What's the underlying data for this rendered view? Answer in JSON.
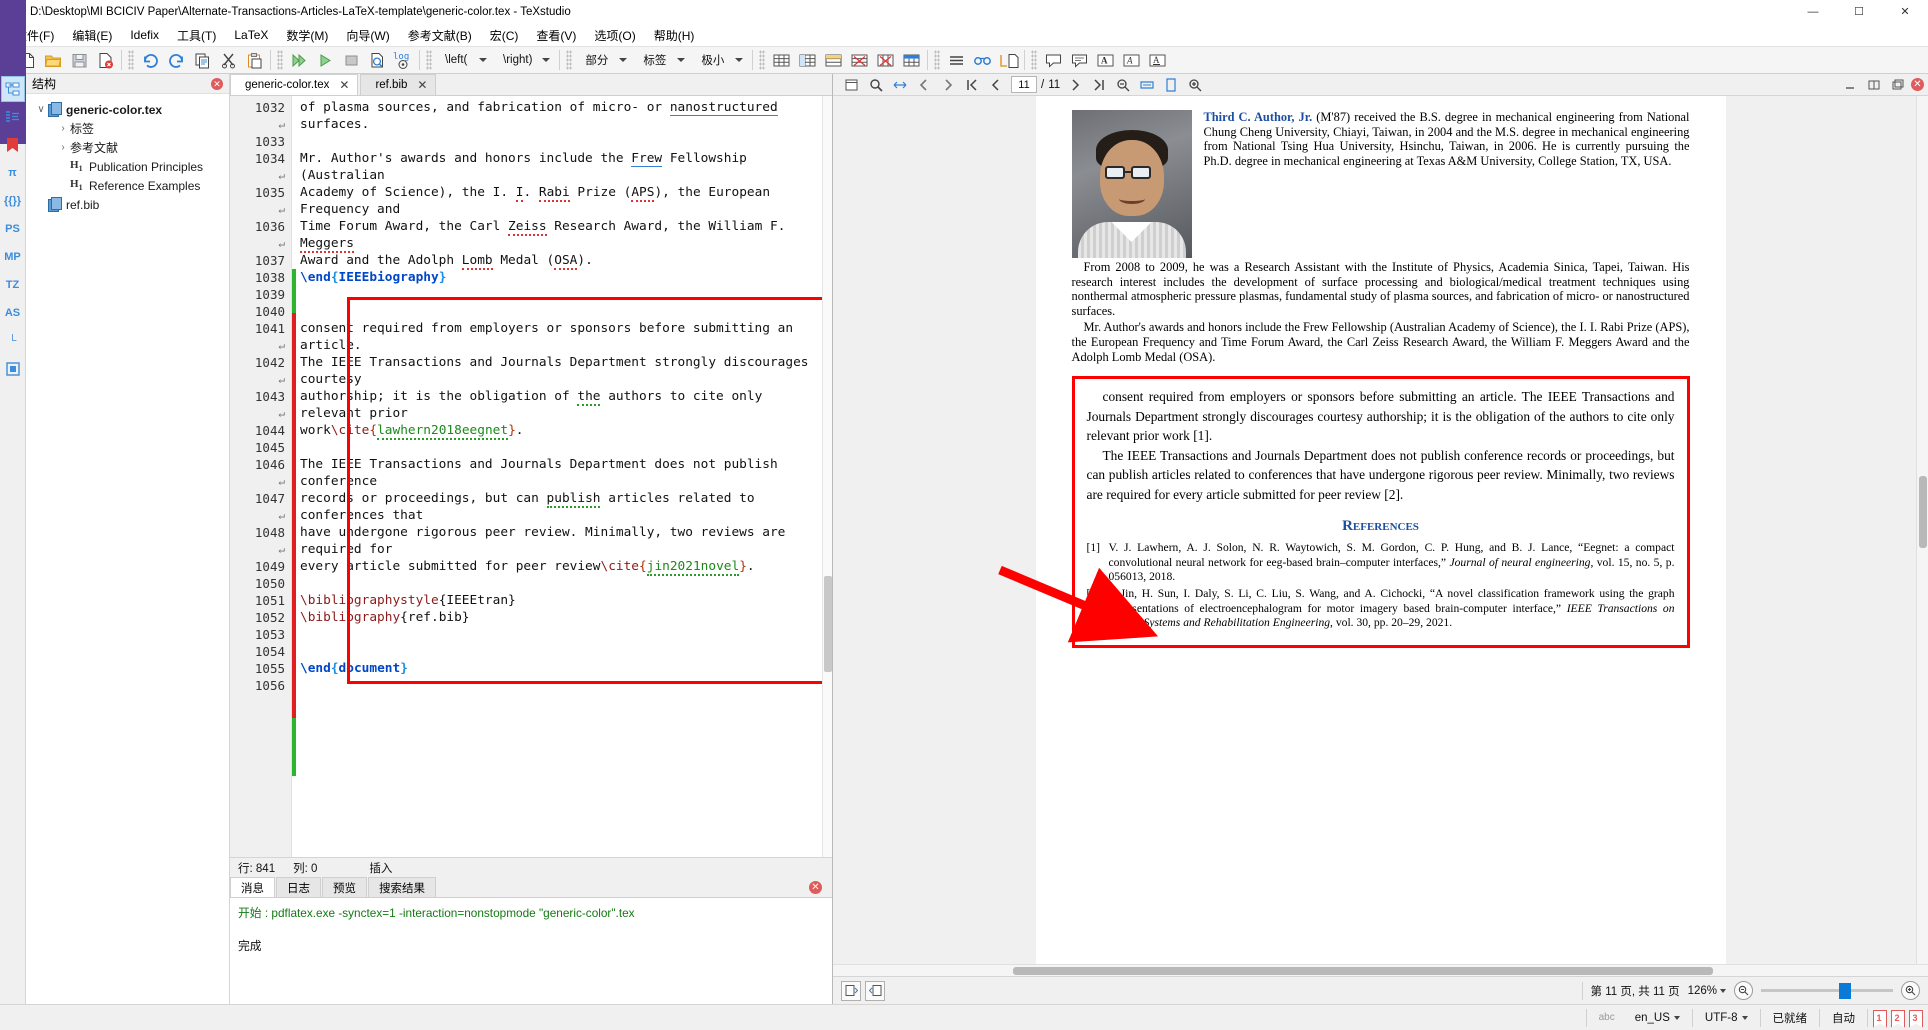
{
  "window": {
    "title": "D:\\Desktop\\MI BCICIV Paper\\Alternate-Transactions-Articles-LaTeX-template\\generic-color.tex - TeXstudio",
    "minimize": "—",
    "maximize": "☐",
    "close": "✕"
  },
  "menubar": [
    {
      "label": "文件(F)"
    },
    {
      "label": "编辑(E)"
    },
    {
      "label": "Idefix"
    },
    {
      "label": "工具(T)"
    },
    {
      "label": "LaTeX"
    },
    {
      "label": "数学(M)"
    },
    {
      "label": "向导(W)"
    },
    {
      "label": "参考文献(B)"
    },
    {
      "label": "宏(C)"
    },
    {
      "label": "查看(V)"
    },
    {
      "label": "选项(O)"
    },
    {
      "label": "帮助(H)"
    }
  ],
  "toolbar": {
    "combos": [
      {
        "name": "left-bracket",
        "label": "\\left("
      },
      {
        "name": "right-bracket",
        "label": "\\right)"
      },
      {
        "name": "section",
        "label": "部分"
      },
      {
        "name": "label",
        "label": "标签"
      },
      {
        "name": "size",
        "label": "极小"
      }
    ],
    "log_label": "log"
  },
  "rail": {
    "items": [
      {
        "name": "structure-view",
        "label": "☰"
      },
      {
        "name": "outline-view",
        "label": "≡"
      },
      {
        "name": "bookmarks",
        "label": "▮"
      },
      {
        "name": "symbols-pi",
        "label": "π"
      },
      {
        "name": "symbols-braces",
        "label": "{{}}"
      },
      {
        "name": "symbols-ps",
        "label": "PS"
      },
      {
        "name": "symbols-mp",
        "label": "MP"
      },
      {
        "name": "symbols-tz",
        "label": "TZ"
      },
      {
        "name": "symbols-as",
        "label": "AS"
      },
      {
        "name": "symbols-l",
        "label": "└"
      },
      {
        "name": "symbols-misc",
        "label": "▣"
      }
    ]
  },
  "structure": {
    "header": "结构",
    "tree": [
      {
        "indent": 0,
        "twisty": "∨",
        "icon": "doc",
        "label": "generic-color.tex",
        "bold": true
      },
      {
        "indent": 1,
        "twisty": "›",
        "icon": "none",
        "label": "标签",
        "bold": false
      },
      {
        "indent": 1,
        "twisty": "›",
        "icon": "none",
        "label": "参考文献",
        "bold": false
      },
      {
        "indent": 1,
        "twisty": "",
        "icon": "h1",
        "label": "Publication Principles",
        "bold": false
      },
      {
        "indent": 1,
        "twisty": "",
        "icon": "h1",
        "label": "Reference Examples",
        "bold": false
      },
      {
        "indent": 0,
        "twisty": "",
        "icon": "doc",
        "label": "ref.bib",
        "bold": false
      }
    ]
  },
  "tabs": [
    {
      "name": "tab-generic-color",
      "label": "generic-color.tex",
      "active": true,
      "close": "✕"
    },
    {
      "name": "tab-ref-bib",
      "label": "ref.bib",
      "active": false,
      "close": "✕"
    }
  ],
  "editor": {
    "lines": [
      {
        "num": "1032",
        "text": "of plasma sources, and fabrication of micro- or nanostructured",
        "spell": "nanostructured"
      },
      {
        "num": "↵",
        "text": "surfaces."
      },
      {
        "num": "1033",
        "text": ""
      },
      {
        "num": "1034",
        "text": "Mr. Author's awards and honors include the Frew Fellowship",
        "spell": "Frew"
      },
      {
        "num": "↵",
        "text": "(Australian"
      },
      {
        "num": "1035",
        "text": "Academy of Science), the I. I. Rabi Prize (APS), the European"
      },
      {
        "num": "↵",
        "text": "Frequency and"
      },
      {
        "num": "1036",
        "text": "Time Forum Award, the Carl Zeiss Research Award, the William F."
      },
      {
        "num": "↵",
        "text": "Meggers"
      },
      {
        "num": "1037",
        "text": "Award and the Adolph Lomb Medal (OSA)."
      },
      {
        "num": "1038",
        "text": "\\end{IEEEbiography}"
      },
      {
        "num": "1039",
        "text": ""
      },
      {
        "num": "1040",
        "text": ""
      },
      {
        "num": "1041",
        "text": "consent required from employers or sponsors before submitting an"
      },
      {
        "num": "↵",
        "text": "article."
      },
      {
        "num": "1042",
        "text": "The IEEE Transactions and Journals Department strongly discourages"
      },
      {
        "num": "↵",
        "text": "courtesy"
      },
      {
        "num": "1043",
        "text": "authorship; it is the obligation of the authors to cite only"
      },
      {
        "num": "↵",
        "text": "relevant prior"
      },
      {
        "num": "1044",
        "text": "work\\cite{lawhern2018eegnet}."
      },
      {
        "num": "1045",
        "text": ""
      },
      {
        "num": "1046",
        "text": "The IEEE Transactions and Journals Department does not publish"
      },
      {
        "num": "↵",
        "text": "conference"
      },
      {
        "num": "1047",
        "text": "records or proceedings, but can publish articles related to"
      },
      {
        "num": "↵",
        "text": "conferences that"
      },
      {
        "num": "1048",
        "text": "have undergone rigorous peer review. Minimally, two reviews are"
      },
      {
        "num": "↵",
        "text": "required for"
      },
      {
        "num": "1049",
        "text": "every article submitted for peer review\\cite{jin2021novel}."
      },
      {
        "num": "1050",
        "text": ""
      },
      {
        "num": "1051",
        "text": "\\bibliographystyle{IEEEtran}"
      },
      {
        "num": "1052",
        "text": "\\bibliography{ref.bib}"
      },
      {
        "num": "1053",
        "text": ""
      },
      {
        "num": "1054",
        "text": ""
      },
      {
        "num": "1055",
        "text": "\\end{document}"
      },
      {
        "num": "1056",
        "text": ""
      }
    ],
    "status": {
      "row_label": "行:",
      "row_value": "841",
      "col_label": "列:",
      "col_value": "0",
      "mode": "插入"
    }
  },
  "messages": {
    "tabs": [
      {
        "name": "tab-messages",
        "label": "消息",
        "active": true
      },
      {
        "name": "tab-log",
        "label": "日志",
        "active": false
      },
      {
        "name": "tab-preview",
        "label": "预览",
        "active": false
      },
      {
        "name": "tab-search-results",
        "label": "搜索结果",
        "active": false
      }
    ],
    "close": "✕",
    "line1": "开始 : pdflatex.exe -synctex=1 -interaction=nonstopmode \"generic-color\".tex",
    "line2": "完成"
  },
  "pdf": {
    "toolbar": {
      "page_current": "11",
      "page_sep": "/",
      "page_total": "11"
    },
    "close": "✕",
    "bio": {
      "name": "Third C. Author, Jr.",
      "intro": " (M'87) received the B.S. degree in mechanical engineering from National Chung Cheng University, Chiayi, Taiwan, in 2004 and the M.S. degree in mechanical engineering from National Tsing Hua University, Hsinchu, Taiwan, in 2006. He is currently pursuing the Ph.D. degree in mechanical engineering at Texas A&M University, College Station, TX, USA.",
      "para2": "From 2008 to 2009, he was a Research Assistant with the Institute of Physics, Academia Sinica, Tapei, Taiwan. His research interest includes the development of surface processing and biological/medical treatment techniques using nonthermal atmospheric pressure plasmas, fundamental study of plasma sources, and fabrication of micro- or nanostructured surfaces.",
      "para3": "Mr. Author's awards and honors include the Frew Fellowship (Australian Academy of Science), the I. I. Rabi Prize (APS), the European Frequency and Time Forum Award, the Carl Zeiss Research Award, the William F. Meggers Award and the Adolph Lomb Medal (OSA)."
    },
    "boxed": {
      "para1": "consent required from employers or sponsors before submitting an article. The IEEE Transactions and Journals Department strongly discourages courtesy authorship; it is the obligation of the authors to cite only relevant prior work [1].",
      "para2": "The IEEE Transactions and Journals Department does not publish conference records or proceedings, but can publish articles related to conferences that have undergone rigorous peer review. Minimally, two reviews are required for every article submitted for peer review [2].",
      "references_heading": "References",
      "references": [
        {
          "num": "[1]",
          "pre": "V. J. Lawhern, A. J. Solon, N. R. Waytowich, S. M. Gordon, C. P. Hung, and B. J. Lance, “Eegnet: a compact convolutional neural network for eeg-based brain–computer interfaces,” ",
          "italic": "Journal of neural engineering",
          "post": ", vol. 15, no. 5, p. 056013, 2018."
        },
        {
          "num": "[2]",
          "pre": "J. Jin, H. Sun, I. Daly, S. Li, C. Liu, S. Wang, and A. Cichocki, “A novel classification framework using the graph representations of electroencephalogram for motor imagery based brain-computer interface,” ",
          "italic": "IEEE Transactions on Neural Systems and Rehabilitation Engineering",
          "post": ", vol. 30, pp. 20–29, 2021."
        }
      ]
    },
    "bottom": {
      "page_label": "第 11 页, 共 11 页",
      "zoom": "126%"
    }
  },
  "statusbar": {
    "spell_icon": "abc",
    "language": "en_US",
    "encoding": "UTF-8",
    "ready": "已就绪",
    "auto": "自动",
    "bookmarks": [
      "1",
      "2",
      "3"
    ]
  },
  "colors": {
    "accent_red": "#ff0000",
    "link_blue": "#1c4fa1",
    "keyword_blue": "#0047c7",
    "purple_rail": "#5b3f97",
    "changebar_green": "#2db52d",
    "changebar_red": "#e02020"
  }
}
